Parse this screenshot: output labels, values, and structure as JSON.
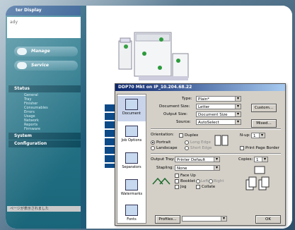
{
  "nav": {
    "title": "ter Display",
    "status_text": "ady",
    "pills": [
      {
        "label": "Manage"
      },
      {
        "label": "Service"
      }
    ],
    "status_section": "Status",
    "status_items": [
      "General",
      "Tray",
      "Finisher",
      "Consumables",
      "Errors",
      "Usage",
      "Network",
      "Reports",
      "Firmware"
    ],
    "system_section": "System",
    "config_section": "Configuration",
    "footer_status": "ページが表示されました"
  },
  "dialog": {
    "title": "DDP70 Mkt on IP_10.204.68.22",
    "tabs": [
      {
        "label": "Document",
        "icon": "document-icon"
      },
      {
        "label": "Job Options",
        "icon": "job-options-icon"
      },
      {
        "label": "Separators",
        "icon": "separators-icon"
      },
      {
        "label": "Watermarks",
        "icon": "watermarks-icon"
      },
      {
        "label": "Fonts",
        "icon": "fonts-icon"
      }
    ],
    "fields": {
      "type_label": "Type:",
      "type_value": "Plain*",
      "doc_size_label": "Document Size:",
      "doc_size_value": "Letter",
      "out_size_label": "Output Size:",
      "out_size_value": "Document Size",
      "source_label": "Source:",
      "source_value": "AutoSelect",
      "custom_button": "Custom...",
      "mixed_button": "Mixed...",
      "orientation_label": "Orientation:",
      "portrait": "Portrait",
      "landscape": "Landscape",
      "duplex": "Duplex",
      "long_edge": "Long Edge",
      "short_edge": "Short Edge",
      "nup_label": "N-up:",
      "nup_value": "1",
      "print_page_border": "Print Page Border",
      "output_tray_label": "Output Tray:",
      "output_tray_value": "Printer Default",
      "stapling_label": "Stapling:",
      "stapling_value": "None",
      "face_up": "Face Up",
      "booklet": "Booklet",
      "left": "Left",
      "right": "Right",
      "jog": "Jog",
      "collate": "Collate",
      "copies_label": "Copies:",
      "copies_value": "1",
      "profiles_button": "Profiles...",
      "ok_button": "OK"
    }
  }
}
